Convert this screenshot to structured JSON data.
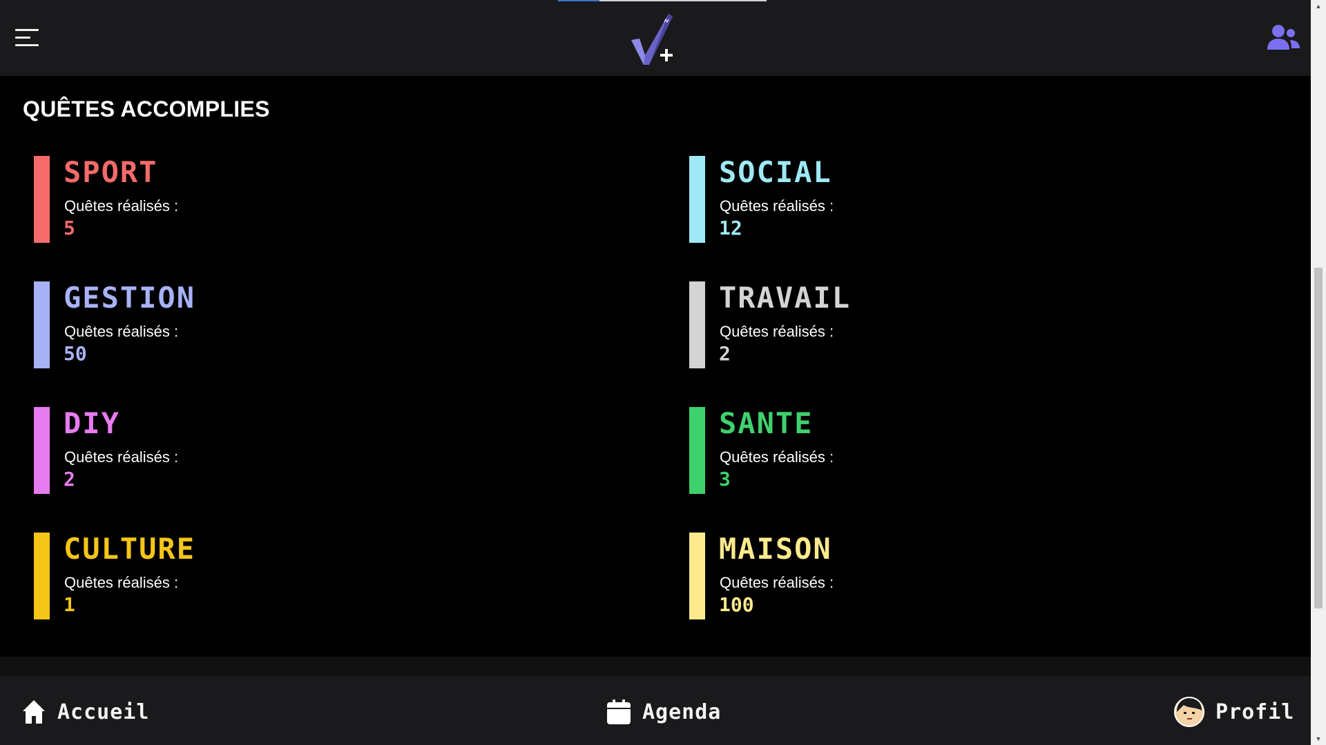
{
  "header": {
    "menu_icon": "hamburger-menu-icon",
    "logo_icon": "checkmark-plus-logo",
    "friends_icon": "users-icon",
    "friends_color": "#7b6ff0",
    "progress_fraction": 0.2
  },
  "main": {
    "title": "QUÊTES ACCOMPLIES",
    "categories": [
      {
        "name": "SPORT",
        "label": "Quêtes réalisés :",
        "count": "5",
        "color": "#f56b6b"
      },
      {
        "name": "SOCIAL",
        "label": "Quêtes réalisés :",
        "count": "12",
        "color": "#9ee9f5"
      },
      {
        "name": "GESTION",
        "label": "Quêtes réalisés :",
        "count": "50",
        "color": "#a8b2f7"
      },
      {
        "name": "TRAVAIL",
        "label": "Quêtes réalisés :",
        "count": "2",
        "color": "#d4d4d4"
      },
      {
        "name": "DIY",
        "label": "Quêtes réalisés :",
        "count": "2",
        "color": "#e67cf0"
      },
      {
        "name": "SANTE",
        "label": "Quêtes réalisés :",
        "count": "3",
        "color": "#3fd16e"
      },
      {
        "name": "CULTURE",
        "label": "Quêtes réalisés :",
        "count": "1",
        "color": "#f5c518"
      },
      {
        "name": "MAISON",
        "label": "Quêtes réalisés :",
        "count": "100",
        "color": "#fdea8c"
      }
    ]
  },
  "bottom_nav": {
    "home": {
      "label": "Accueil",
      "icon": "home-icon"
    },
    "agenda": {
      "label": "Agenda",
      "icon": "calendar-icon"
    },
    "profile": {
      "label": "Profil",
      "icon": "avatar-icon"
    }
  }
}
